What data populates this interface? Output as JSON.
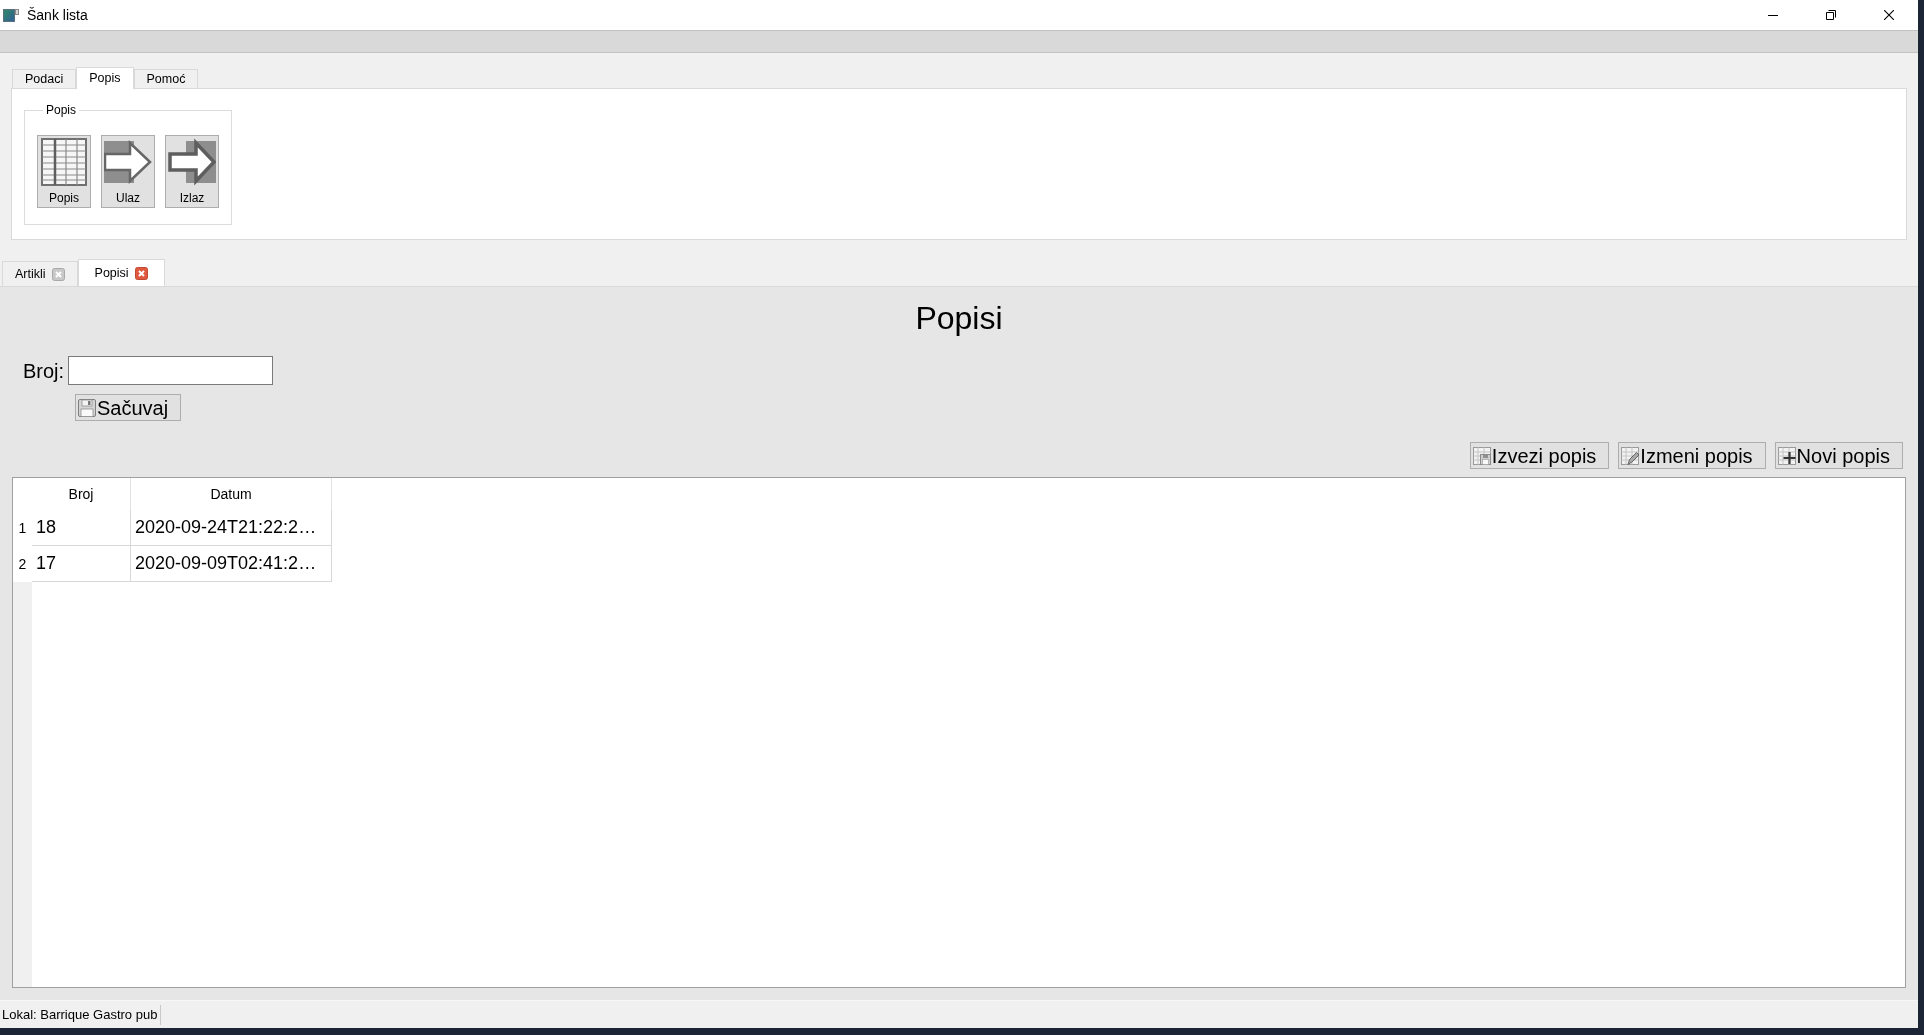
{
  "window": {
    "title": "Šank lista"
  },
  "ribbon": {
    "tabs": [
      {
        "label": "Podaci",
        "selected": false
      },
      {
        "label": "Popis",
        "selected": true
      },
      {
        "label": "Pomoć",
        "selected": false
      }
    ],
    "groups": [
      {
        "title": "Popis",
        "buttons": [
          {
            "label": "Popis",
            "kind": "list"
          },
          {
            "label": "Ulaz",
            "kind": "entry"
          },
          {
            "label": "Izlaz",
            "kind": "exit"
          }
        ]
      }
    ]
  },
  "document_tabs": [
    {
      "label": "Artikli",
      "selected": false
    },
    {
      "label": "Popisi",
      "selected": true
    }
  ],
  "page": {
    "title": "Popisi",
    "form": {
      "fields": [
        {
          "label": "Broj:"
        }
      ],
      "save_button": "Sačuvaj"
    },
    "actions": [
      {
        "label": "Izvezi popis",
        "kind": "export"
      },
      {
        "label": "Izmeni popis",
        "kind": "edit"
      },
      {
        "label": "Novi popis",
        "kind": "new"
      }
    ],
    "table": {
      "columns": [
        "Broj",
        "Datum"
      ],
      "rows": [
        {
          "number": "1",
          "cells": [
            "18",
            "2020-09-24T21:22:2…"
          ]
        },
        {
          "number": "2",
          "cells": [
            "17",
            "2020-09-09T02:41:2…"
          ]
        }
      ]
    }
  },
  "status_bar": {
    "text": "Lokal: Barrique Gastro pub"
  }
}
